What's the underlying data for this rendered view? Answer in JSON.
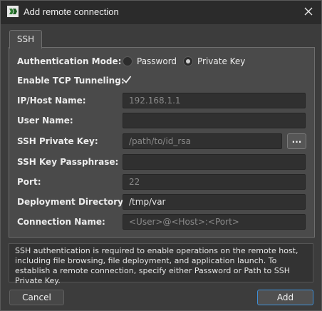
{
  "window": {
    "title": "Add remote connection"
  },
  "tabs": [
    {
      "label": "SSH",
      "active": true
    }
  ],
  "form": {
    "auth_mode": {
      "label": "Authentication Mode:",
      "options": [
        "Password",
        "Private Key"
      ],
      "selected": "Private Key"
    },
    "tcp_tunneling": {
      "label": "Enable TCP Tunneling:",
      "checked": true
    },
    "host": {
      "label": "IP/Host Name:",
      "value": "",
      "placeholder": "192.168.1.1"
    },
    "user": {
      "label": "User Name:",
      "value": "",
      "placeholder": ""
    },
    "private_key": {
      "label": "SSH Private Key:",
      "value": "",
      "placeholder": "/path/to/id_rsa",
      "browse_label": "..."
    },
    "passphrase": {
      "label": "SSH Key Passphrase:",
      "value": "",
      "placeholder": ""
    },
    "port": {
      "label": "Port:",
      "value": "",
      "placeholder": "22"
    },
    "deploy_dir": {
      "label": "Deployment Directory:",
      "value": "/tmp/var",
      "placeholder": ""
    },
    "conn_name": {
      "label": "Connection Name:",
      "value": "",
      "placeholder": "<User>@<Host>:<Port>"
    }
  },
  "info_text": "SSH authentication is required to enable operations on the remote host, including file browsing, file deployment, and application launch. To establish a remote connection, specify either Password or Path to SSH Private Key.",
  "buttons": {
    "cancel": "Cancel",
    "add": "Add"
  },
  "colors": {
    "accent": "#3d8fd8",
    "background": "#3c3c3c",
    "panel": "#4a4a4a",
    "field": "#303030"
  },
  "icons": {
    "app": "app-logo-icon",
    "close": "close-icon",
    "check": "checkmark-icon"
  }
}
